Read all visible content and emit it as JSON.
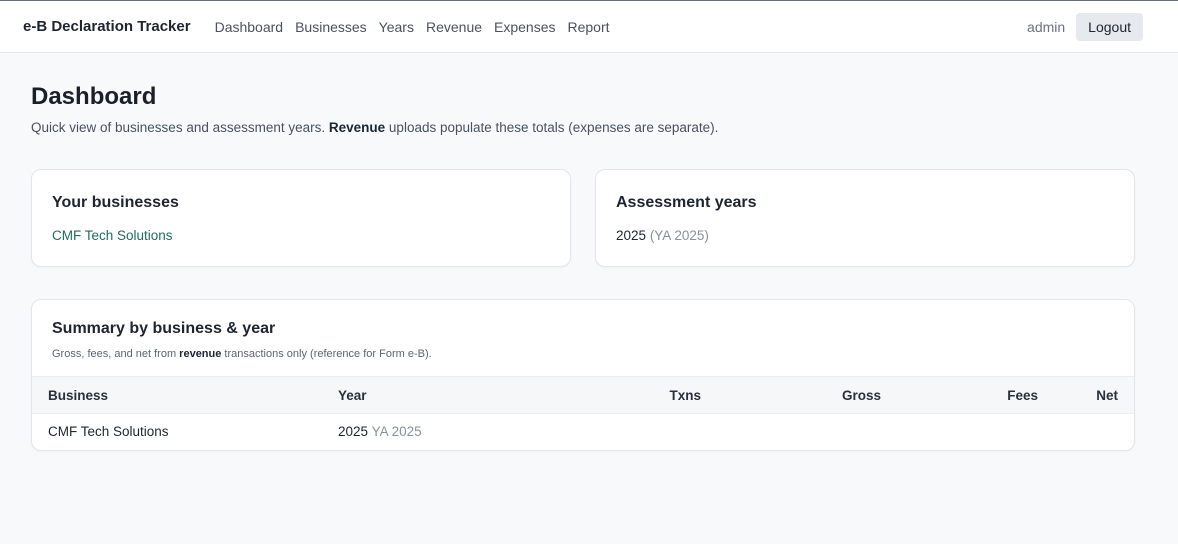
{
  "nav": {
    "brand": "e-B Declaration Tracker",
    "links": [
      "Dashboard",
      "Businesses",
      "Years",
      "Revenue",
      "Expenses",
      "Report"
    ],
    "user": "admin",
    "logout_label": "Logout"
  },
  "page": {
    "title": "Dashboard",
    "subtitle_before": "Quick view of businesses and assessment years. ",
    "subtitle_bold": "Revenue",
    "subtitle_after": " uploads populate these totals (expenses are separate)."
  },
  "businesses_card": {
    "title": "Your businesses",
    "items": [
      "CMF Tech Solutions"
    ]
  },
  "years_card": {
    "title": "Assessment years",
    "year": "2025",
    "ya_label": "(YA 2025)"
  },
  "summary": {
    "title": "Summary by business & year",
    "note_before": "Gross, fees, and net from ",
    "note_bold": "revenue",
    "note_after": " transactions only (reference for Form e-B).",
    "columns": [
      "Business",
      "Year",
      "Txns",
      "Gross",
      "Fees",
      "Net"
    ],
    "rows": [
      {
        "business": "CMF Tech Solutions",
        "year": "2025",
        "ya": "YA 2025",
        "txns": "",
        "gross": "",
        "fees": "",
        "net": ""
      }
    ]
  },
  "colors": {
    "link": "#1d6f5c",
    "background": "#f8f9fb",
    "card": "#ffffff",
    "button": "#e6e9ee"
  }
}
